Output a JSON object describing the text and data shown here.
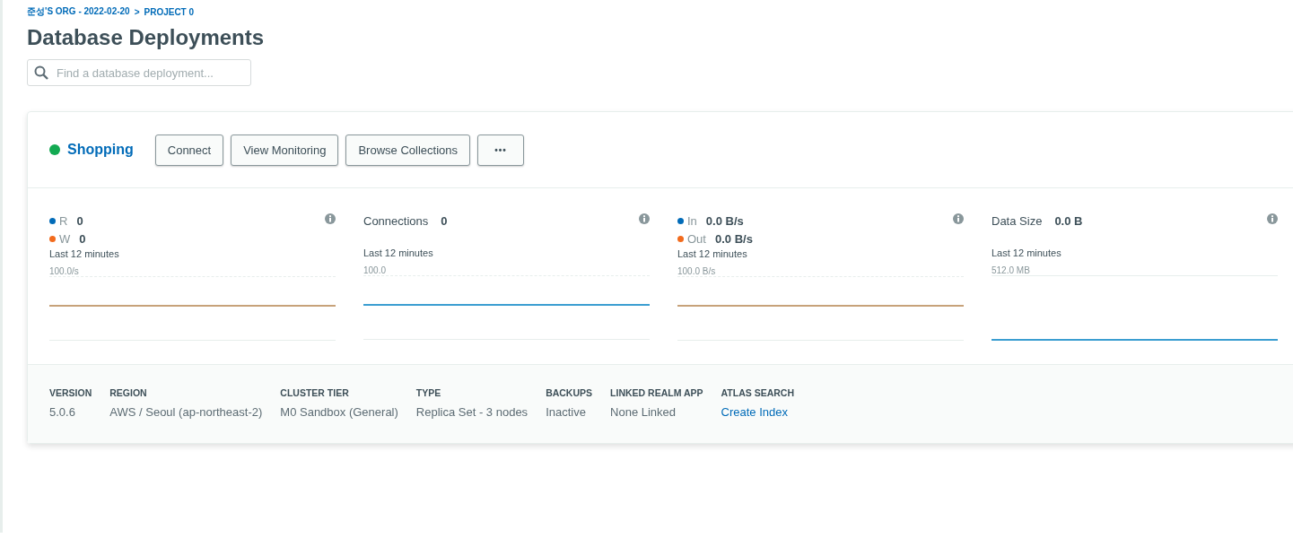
{
  "breadcrumb": {
    "org": "준성'S ORG - 2022-02-20",
    "separator": ">",
    "project": "PROJECT 0"
  },
  "title": "Database Deployments",
  "search": {
    "placeholder": "Find a database deployment..."
  },
  "cluster": {
    "name": "Shopping",
    "running": true,
    "buttons": [
      "Connect",
      "View Monitoring",
      "Browse Collections",
      "•••"
    ],
    "metrics": [
      {
        "kind": "rate",
        "series": [
          {
            "label": "R",
            "value": "0",
            "color": "#016bb8"
          },
          {
            "label": "W",
            "value": "0",
            "color": "#f26b1d"
          }
        ],
        "period": "Last 12 minutes",
        "axis_label": "100.0/s"
      },
      {
        "kind": "rate",
        "title": "Connections",
        "value": "0",
        "period": "Last 12 minutes",
        "axis_label": "100.0"
      },
      {
        "kind": "rate",
        "series": [
          {
            "label": "In",
            "value": "0.0 B/s",
            "color": "#016bb8"
          },
          {
            "label": "Out",
            "value": "0.0 B/s",
            "color": "#f26b1d"
          }
        ],
        "period": "Last 12 minutes",
        "axis_label": "100.0 B/s"
      },
      {
        "kind": "size",
        "title": "Data Size",
        "value": "0.0 B",
        "period": "Last 12 minutes",
        "axis_label": "512.0 MB"
      }
    ],
    "details": [
      {
        "label": "VERSION",
        "value": "5.0.6"
      },
      {
        "label": "REGION",
        "value": "AWS / Seoul (ap-northeast-2)"
      },
      {
        "label": "CLUSTER TIER",
        "value": "M0 Sandbox (General)"
      },
      {
        "label": "TYPE",
        "value": "Replica Set - 3 nodes"
      },
      {
        "label": "BACKUPS",
        "value": "Inactive"
      },
      {
        "label": "LINKED REALM APP",
        "value": "None Linked"
      },
      {
        "label": "ATLAS SEARCH",
        "value": "Create Index",
        "kind": "link"
      }
    ]
  }
}
